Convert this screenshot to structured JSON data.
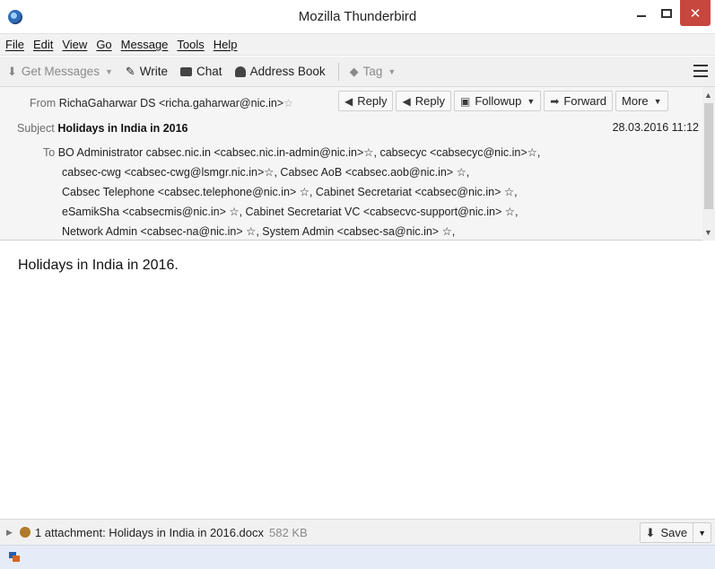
{
  "window": {
    "title": "Mozilla Thunderbird",
    "close_glyph": "✕"
  },
  "menu": [
    "File",
    "Edit",
    "View",
    "Go",
    "Message",
    "Tools",
    "Help"
  ],
  "toolbar": {
    "get_messages": "Get Messages",
    "write": "Write",
    "chat": "Chat",
    "address_book": "Address Book",
    "tag": "Tag"
  },
  "header": {
    "from_label": "From",
    "from_value": "RichaGaharwar DS <richa.gaharwar@nic.in>",
    "subject_label": "Subject",
    "subject_value": "Holidays in India in 2016",
    "date": "28.03.2016 11:12",
    "to_label": "To",
    "to_lines": [
      "BO Administrator cabsec.nic.in <cabsec.nic.in-admin@nic.in>☆, cabsecyc <cabsecyc@nic.in>☆,",
      "cabsec-cwg <cabsec-cwg@lsmgr.nic.in>☆, Cabsec AoB <cabsec.aob@nic.in> ☆,",
      "Cabsec Telephone <cabsec.telephone@nic.in> ☆, Cabinet Secretariat <cabsec@nic.in> ☆,",
      "eSamikSha <cabsecmis@nic.in> ☆, Cabinet Secretariat VC <cabsecvc-support@nic.in> ☆,",
      "Network Admin <cabsec-na@nic.in> ☆, System Admin <cabsec-sa@nic.in> ☆,"
    ],
    "buttons": {
      "reply1": "Reply",
      "reply2": "Reply",
      "followup": "Followup",
      "forward": "Forward",
      "more": "More"
    }
  },
  "body": {
    "text": "Holidays in India in 2016."
  },
  "attachment": {
    "summary": "1 attachment: Holidays in India in 2016.docx",
    "size": "582 KB",
    "save": "Save"
  },
  "colors": {
    "close_button": "#c7463d",
    "statusbar": "#e5ecf7"
  }
}
